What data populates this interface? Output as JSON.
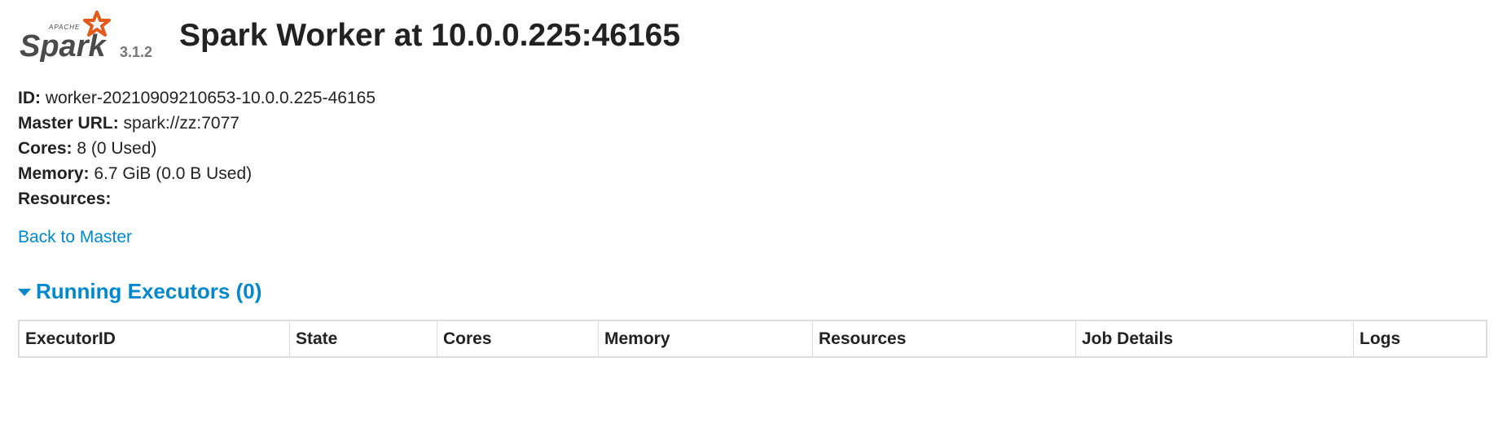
{
  "header": {
    "logo_text": "Spark",
    "logo_tagline": "APACHE",
    "version": "3.1.2",
    "title": "Spark Worker at 10.0.0.225:46165"
  },
  "info": {
    "id_label": "ID:",
    "id_value": "worker-20210909210653-10.0.0.225-46165",
    "master_url_label": "Master URL:",
    "master_url_value": "spark://zz:7077",
    "cores_label": "Cores:",
    "cores_value": "8 (0 Used)",
    "memory_label": "Memory:",
    "memory_value": "6.7 GiB (0.0 B Used)",
    "resources_label": "Resources:"
  },
  "back_link": "Back to Master",
  "running_executors": {
    "title": "Running Executors (0)",
    "columns": [
      "ExecutorID",
      "State",
      "Cores",
      "Memory",
      "Resources",
      "Job Details",
      "Logs"
    ]
  },
  "colors": {
    "link": "#0088cc",
    "spark_orange": "#e25a1c",
    "border": "#dddddd"
  }
}
